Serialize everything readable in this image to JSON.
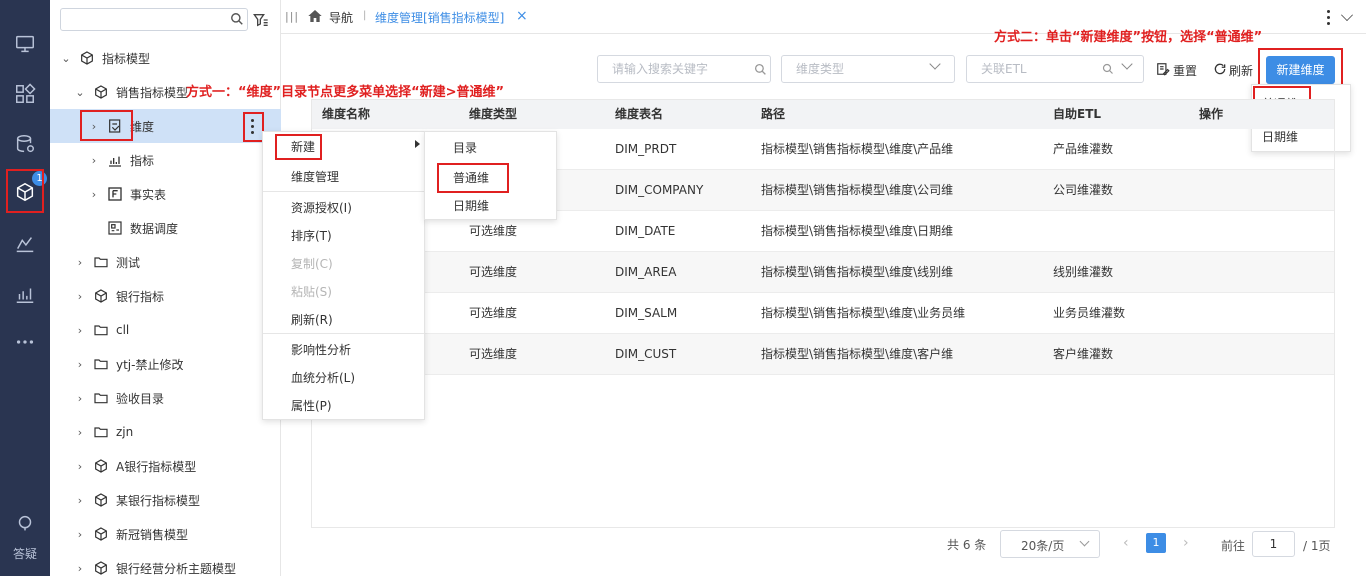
{
  "rail": {
    "badge": "1",
    "help_label": "答疑"
  },
  "tree": {
    "search_placeholder": "",
    "items": [
      {
        "label": "指标模型"
      },
      {
        "label": "销售指标模型"
      },
      {
        "label": "维度"
      },
      {
        "label": "指标"
      },
      {
        "label": "事实表"
      },
      {
        "label": "数据调度"
      },
      {
        "label": "测试"
      },
      {
        "label": "银行指标"
      },
      {
        "label": "cll"
      },
      {
        "label": "ytj-禁止修改"
      },
      {
        "label": "验收目录"
      },
      {
        "label": "zjn"
      },
      {
        "label": "A银行指标模型"
      },
      {
        "label": "某银行指标模型"
      },
      {
        "label": "新冠销售模型"
      },
      {
        "label": "银行经营分析主题模型"
      }
    ]
  },
  "topbar": {
    "nav_label": "导航",
    "active_tab": "维度管理[销售指标模型]",
    "close": "×"
  },
  "toolbar": {
    "search_placeholder": "请输入搜索关键字",
    "dim_type_placeholder": "维度类型",
    "etl_placeholder": "关联ETL",
    "reset_label": "重置",
    "refresh_label": "刷新",
    "new_dim_label": "新建维度"
  },
  "new_dim_dropdown": {
    "items": [
      "普通维",
      "日期维"
    ]
  },
  "table": {
    "columns": [
      "维度名称",
      "维度类型",
      "维度表名",
      "路径",
      "自助ETL",
      "操作"
    ],
    "rows": [
      {
        "name": "",
        "type": "",
        "table": "DIM_PRDT",
        "path": "指标模型\\销售指标模型\\维度\\产品维",
        "etl": "产品维灌数"
      },
      {
        "name": "",
        "type": "",
        "table": "DIM_COMPANY",
        "path": "指标模型\\销售指标模型\\维度\\公司维",
        "etl": "公司维灌数"
      },
      {
        "name": "",
        "type": "可选维度",
        "table": "DIM_DATE",
        "path": "指标模型\\销售指标模型\\维度\\日期维",
        "etl": ""
      },
      {
        "name": "",
        "type": "可选维度",
        "table": "DIM_AREA",
        "path": "指标模型\\销售指标模型\\维度\\线别维",
        "etl": "线别维灌数"
      },
      {
        "name": "",
        "type": "可选维度",
        "table": "DIM_SALM",
        "path": "指标模型\\销售指标模型\\维度\\业务员维",
        "etl": "业务员维灌数"
      },
      {
        "name": "",
        "type": "可选维度",
        "table": "DIM_CUST",
        "path": "指标模型\\销售指标模型\\维度\\客户维",
        "etl": "客户维灌数"
      }
    ]
  },
  "context_menu": {
    "items": [
      {
        "label": "新建",
        "disabled": false
      },
      {
        "label": "维度管理",
        "disabled": false
      },
      {
        "label": "资源授权(I)",
        "disabled": false
      },
      {
        "label": "排序(T)",
        "disabled": false
      },
      {
        "label": "复制(C)",
        "disabled": true
      },
      {
        "label": "粘贴(S)",
        "disabled": true
      },
      {
        "label": "刷新(R)",
        "disabled": false
      },
      {
        "label": "影响性分析",
        "disabled": false
      },
      {
        "label": "血统分析(L)",
        "disabled": false
      },
      {
        "label": "属性(P)",
        "disabled": false
      }
    ]
  },
  "submenu": {
    "items": [
      "目录",
      "普通维",
      "日期维"
    ]
  },
  "annotations": {
    "method_one": "方式一：“维度”目录节点更多菜单选择“新建>普通维”",
    "method_two": "方式二：单击“新建维度”按钮，选择“普通维”"
  },
  "pagination": {
    "total": "共 6 条",
    "page_size": "20条/页",
    "current_page": "1",
    "goto_label": "前往",
    "goto_value": "1",
    "total_pages": "/ 1页"
  },
  "colors": {
    "rail_bg": "#2a3551",
    "accent": "#3d8de5",
    "annotation_red": "#e02020",
    "tree_selected": "#cfe1f7"
  }
}
